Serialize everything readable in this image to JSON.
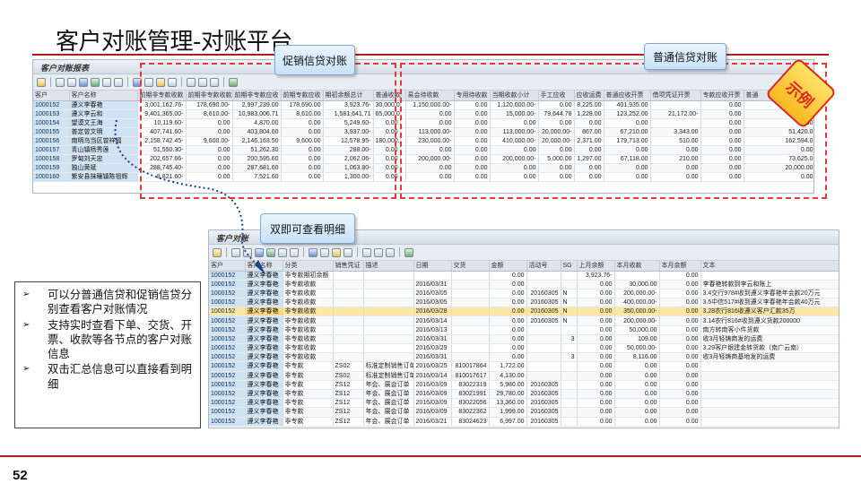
{
  "slide": {
    "title": "客户对账管理-对账平台",
    "page_number": "52",
    "stamp_text": "示例"
  },
  "callouts": {
    "promo": "促销信贷对账",
    "normal": "普通信贷对账",
    "detail": "双即可查看明细"
  },
  "bullets": [
    {
      "marker": "➢",
      "text": "可以分普通信贷和促销信贷分别查看客户对账情况"
    },
    {
      "marker": "➢",
      "text": "支持实时查看下单、交货、开票、收款等各节点的客户对账信息"
    },
    {
      "marker": "➢",
      "text": "双击汇总信息可以直接看到明细"
    }
  ],
  "summary_window": {
    "title": "客户对账报表",
    "columns": [
      "客户",
      "客户名称",
      "前期非专款收款",
      "前期非专款收款",
      "前期非专款应收",
      "前期专款应收",
      "期初余额总计",
      "普通收款",
      "",
      "易会待收款",
      "专用待收款",
      "当期收款小计",
      "手工应收",
      "应收运费",
      "普通应收开票",
      "借项凭证开票",
      "专款应收开票",
      "普通"
    ],
    "rows": [
      [
        "1000152",
        "遵义李春艳",
        "3,001,162.76-",
        "178,690.00-",
        "2,997,239.00",
        "178,690.00",
        "3,923.76-",
        "30,000.00",
        "",
        "1,150,000.00-",
        "0.00",
        "1,120,000.00-",
        "0.00",
        "8,225.00",
        "401,935.00",
        "",
        "0.00",
        "410,1"
      ],
      [
        "1000153",
        "遵义李云和",
        "9,401,365.00-",
        "8,610.00-",
        "10,983,006.71",
        "8,610.00",
        "1,581,641.71",
        "65,000.00-",
        "",
        "0.00",
        "0.00",
        "15,000.00-",
        "79,644.78",
        "1,228.00",
        "123,252.00",
        "21,172.00-",
        "0.00",
        "182,952"
      ],
      [
        "1000154",
        "望谟文王海",
        "10,119.60-",
        "0.00",
        "4,870.00",
        "0.00",
        "5,249.60-",
        "0.00",
        "",
        "0.00",
        "0.00",
        "0.00",
        "0.00",
        "0.00",
        "0.00",
        "",
        "0.00",
        "0.00"
      ],
      [
        "1000155",
        "普定曾文明",
        "407,741.60-",
        "0.00",
        "403,804.60",
        "0.00",
        "3,937.00-",
        "0.00",
        "",
        "113,000.00-",
        "0.00",
        "113,000.00-",
        "20,000.00-",
        "867.00",
        "67,210.00",
        "3,343.00",
        "0.00",
        "51,420.0"
      ],
      [
        "1000156",
        "南明乌当区曾祥福",
        "2,158,742.45-",
        "9,600.00-",
        "2,146,163.50",
        "9,600.00",
        "12,578.95-",
        "180,000.00-",
        "",
        "230,000.00-",
        "0.00",
        "410,000.00-",
        "20,000.00-",
        "2,371.00",
        "179,713.00",
        "510.00",
        "0.00",
        "162,594.0"
      ],
      [
        "1000157",
        "青山镇杨秀莲",
        "51,550.30-",
        "0.00",
        "51,262.30",
        "0.00",
        "288.00-",
        "0.00",
        "",
        "0.00",
        "0.00",
        "0.00",
        "0.00",
        "0.00",
        "0.00",
        "0.00",
        "0.00",
        "0.00"
      ],
      [
        "1000158",
        "罗甸刘天忠",
        "202,657.66-",
        "0.00",
        "200,595.60",
        "0.00",
        "2,062.06-",
        "0.00",
        "",
        "200,000.00-",
        "0.00",
        "200,000.00-",
        "5,000.00",
        "1,297.00",
        "67,118.00",
        "210.00",
        "0.00",
        "73,625.0"
      ],
      [
        "1000159",
        "独山黄斌",
        "288,745.40-",
        "0.00",
        "287,681.60",
        "0.00",
        "1,063.80-",
        "0.00",
        "",
        "0.00",
        "0.00",
        "0.00",
        "0.00",
        "0.00",
        "0.00",
        "0.00",
        "0.00",
        "20,000.00"
      ],
      [
        "1000160",
        "紫安县抹穰镇陈祖辉",
        "8,821.60-",
        "0.00",
        "7,521.60",
        "0.00",
        "1,300.00-",
        "0.00",
        "",
        "0.00",
        "0.00",
        "0.00",
        "0.00",
        "0.00",
        "0.00",
        "0.00",
        "0.00",
        "0.00"
      ]
    ]
  },
  "detail_window": {
    "title": "客户对账",
    "columns": [
      "客户",
      "客户名称",
      "分类",
      "销售凭证",
      "描述",
      "日期",
      "交货",
      "金额",
      "活动号",
      "SG",
      "上月余额",
      "本月收款",
      "本月余额",
      "文本"
    ],
    "rows": [
      [
        "1000152",
        "遵义李春艳",
        "非专款期初余额",
        "",
        "",
        "",
        "",
        "0.00",
        "",
        "",
        "3,923.76-",
        "",
        "0.00",
        ""
      ],
      [
        "1000152",
        "遵义李春艳",
        "非专款收款",
        "",
        "",
        "2016/03/31",
        "",
        "0.00",
        "",
        "",
        "0.00",
        "30,000.00",
        "0.00",
        "李春艳转款到李云和账上"
      ],
      [
        "1000152",
        "遵义李春艳",
        "非专款收款",
        "",
        "",
        "2016/03/05",
        "",
        "0.00",
        "20160305",
        "N",
        "0.00",
        "200,000.00-",
        "0.00",
        "3.4交行978#收到遵义李春艳年会款20万元"
      ],
      [
        "1000152",
        "遵义李春艳",
        "非专款收款",
        "",
        "",
        "2016/03/05",
        "",
        "0.00",
        "20160305",
        "N",
        "0.00",
        "400,000.00-",
        "0.00",
        "3.5中信517#收到遵义李春艳年会款40万元"
      ],
      [
        "1000152",
        "遵义李春艳",
        "非专款收款",
        "",
        "",
        "2016/03/28",
        "",
        "0.00",
        "20160305",
        "N",
        "0.00",
        "350,000.00-",
        "0.00",
        "3.28农行816收遵义客户汇款35万"
      ],
      [
        "1000152",
        "遵义李春艳",
        "非专款收款",
        "",
        "",
        "2016/03/14",
        "",
        "0.00",
        "20160305",
        "N",
        "0.00",
        "200,000.00-",
        "0.00",
        "3.14农行816#收到遵义货款200000"
      ],
      [
        "1000152",
        "遵义李春艳",
        "非专款收款",
        "",
        "",
        "2016/03/13",
        "",
        "0.00",
        "",
        "",
        "0.00",
        "50,000.00",
        "0.00",
        "南方转南客小件货款"
      ],
      [
        "1000152",
        "遵义李春艳",
        "非专款收款",
        "",
        "",
        "2016/03/31",
        "",
        "0.00",
        "",
        "3",
        "0.00",
        "109.00",
        "0.00",
        "收3月轻铸商发的运费"
      ],
      [
        "1000152",
        "遵义李春艳",
        "非专款收款",
        "",
        "",
        "2016/03/29",
        "",
        "0.00",
        "",
        "",
        "0.00",
        "50,000.00-",
        "0.00",
        "3.29客户银建金转货款（南广云南）"
      ],
      [
        "1000152",
        "遵义李春艳",
        "非专款收款",
        "",
        "",
        "2016/03/31",
        "",
        "0.00",
        "",
        "3",
        "0.00",
        "8,116.00",
        "0.00",
        "收3月轻铸商基地发的运费"
      ],
      [
        "1000152",
        "遵义李春艳",
        "非专款",
        "ZS02",
        "标准定制销售订单",
        "2016/03/25",
        "810017864",
        "1,722.00",
        "",
        "",
        "0.00",
        "0.00",
        "0.00",
        ""
      ],
      [
        "1000152",
        "遵义李春艳",
        "非专款",
        "ZS02",
        "标准定制销售订单",
        "2016/03/14",
        "810017617",
        "4,130.00",
        "",
        "",
        "0.00",
        "0.00",
        "0.00",
        ""
      ],
      [
        "1000152",
        "遵义李春艳",
        "非专款",
        "ZS12",
        "年会、展会订单",
        "2016/03/09",
        "83022319",
        "5,980.00",
        "20160305",
        "",
        "0.00",
        "0.00",
        "0.00",
        ""
      ],
      [
        "1000152",
        "遵义李春艳",
        "非专款",
        "ZS12",
        "年会、展会订单",
        "2016/03/09",
        "83021991",
        "29,780.00",
        "20160305",
        "",
        "0.00",
        "0.00",
        "0.00",
        ""
      ],
      [
        "1000152",
        "遵义李春艳",
        "非专款",
        "ZS12",
        "年会、展会订单",
        "2016/03/09",
        "83022056",
        "13,360.00",
        "20160305",
        "",
        "0.00",
        "0.00",
        "0.00",
        ""
      ],
      [
        "1000152",
        "遵义李春艳",
        "非专款",
        "ZS12",
        "年会、展会订单",
        "2016/03/09",
        "83022362",
        "1,999.00",
        "20160305",
        "",
        "0.00",
        "0.00",
        "0.00",
        ""
      ],
      [
        "1000152",
        "遵义李春艳",
        "非专款",
        "ZS12",
        "年会、展会订单",
        "2016/03/21",
        "83024623",
        "6,997.00",
        "20160305",
        "",
        "0.00",
        "0.00",
        "0.00",
        ""
      ]
    ],
    "selected_row": 4
  },
  "colors": {
    "accent_red": "#b71c1c",
    "dash_red": "#e53935",
    "key_cell_blue": "#cfe3f3",
    "selected_row": "#fde7a8",
    "callout_blue": "#c8e1f7",
    "stamp_yellow": "#f6b81e"
  }
}
